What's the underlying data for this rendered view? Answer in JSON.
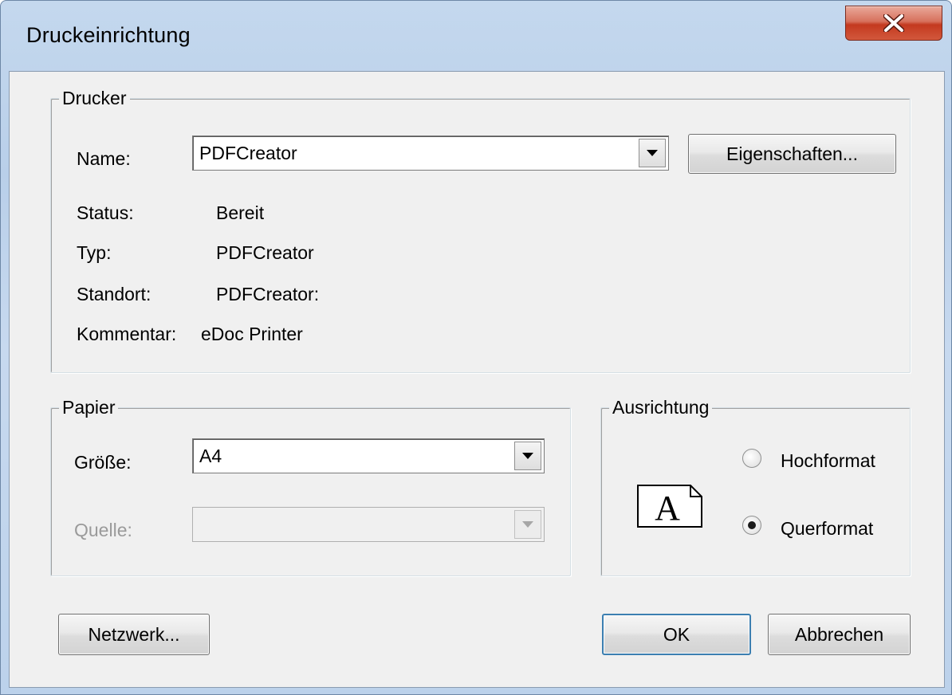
{
  "window": {
    "title": "Druckeinrichtung",
    "close_symbol": "X"
  },
  "printer": {
    "group_label": "Drucker",
    "name_label": "Name:",
    "name_value": "PDFCreator",
    "properties_button": "Eigenschaften...",
    "status_label": "Status:",
    "status_value": "Bereit",
    "type_label": "Typ:",
    "type_value": "PDFCreator",
    "location_label": "Standort:",
    "location_value": "PDFCreator:",
    "comment_label": "Kommentar:",
    "comment_value": "eDoc Printer"
  },
  "paper": {
    "group_label": "Papier",
    "size_label": "Größe:",
    "size_value": "A4",
    "source_label": "Quelle:",
    "source_value": ""
  },
  "orientation": {
    "group_label": "Ausrichtung",
    "icon_letter": "A",
    "portrait_label": "Hochformat",
    "landscape_label": "Querformat",
    "selected": "landscape"
  },
  "footer": {
    "network_button": "Netzwerk...",
    "ok_button": "OK",
    "cancel_button": "Abbrechen"
  }
}
